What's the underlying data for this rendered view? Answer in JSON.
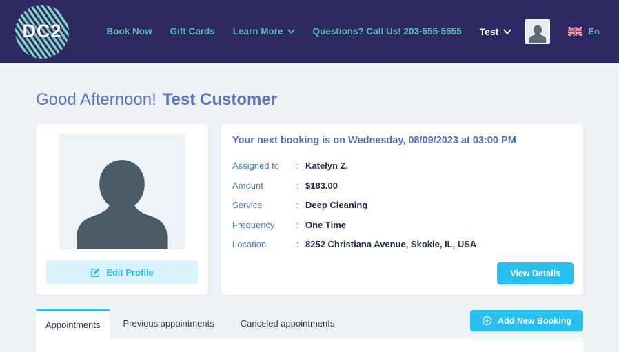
{
  "navbar": {
    "logo_text": "DC2",
    "links": [
      {
        "label": "Book Now"
      },
      {
        "label": "Gift Cards"
      },
      {
        "label": "Learn More"
      }
    ],
    "phone": "Questions? Call Us! 203-555-5555",
    "user_menu_label": "Test",
    "language_label": "En"
  },
  "header": {
    "greeting": "Good Afternoon!",
    "customer_name": "Test Customer"
  },
  "profile_card": {
    "edit_button_label": "Edit Profile"
  },
  "booking_card": {
    "title": "Your next booking is on Wednesday, 08/09/2023 at 03:00 PM",
    "details": [
      {
        "label": "Assigned to",
        "value": "Katelyn  Z."
      },
      {
        "label": "Amount",
        "value": "$183.00"
      },
      {
        "label": "Service",
        "value": "Deep Cleaning"
      },
      {
        "label": "Frequency",
        "value": "One Time"
      },
      {
        "label": "Location",
        "value": "8252 Christiana Avenue, Skokie, IL, USA"
      }
    ],
    "view_details_button_label": "View Details"
  },
  "tabs": [
    {
      "label": "Appointments",
      "active": true
    },
    {
      "label": "Previous appointments",
      "active": false
    },
    {
      "label": "Canceled appointments",
      "active": false
    }
  ],
  "add_booking_button_label": "Add New Booking",
  "icons": {
    "learn_more_chevron": "chevron-down",
    "user_chevron": "chevron-down",
    "edit_profile": "edit-pencil-square",
    "add_booking": "plus-circle",
    "language": "uk-flag",
    "profile_placeholder": "person-silhouette"
  },
  "colors": {
    "navbar_bg": "#2e2963",
    "nav_link_teal": "#54bcae",
    "logo_stripe_mint": "#7fd3c3",
    "heading_blue": "#5b72c7",
    "booking_title_blue": "#4a6fc4",
    "detail_label_blue": "#4a7ab8",
    "detail_value_navy": "#1e2b4d",
    "accent_cyan": "#27c0f1",
    "edit_button_bg": "#d9f3fc",
    "page_bg": "#eef2f7",
    "card_bg": "#ffffff"
  }
}
